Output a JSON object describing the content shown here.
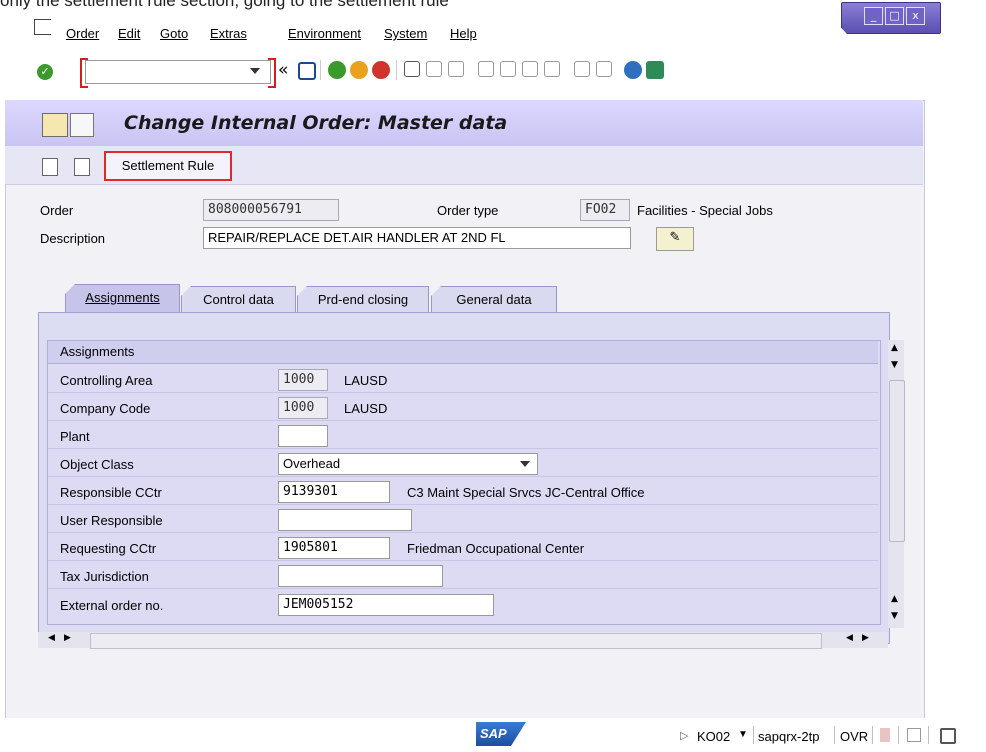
{
  "caption": "only the settlement rule section, going to the settlement rule",
  "menu": [
    "Order",
    "Edit",
    "Goto",
    "Extras",
    "Environment",
    "System",
    "Help"
  ],
  "window_controls": {
    "minimize": "_",
    "maximize": "□",
    "close": "x"
  },
  "toolbar": {
    "command_value": "",
    "history_label": "«"
  },
  "title": "Change Internal Order: Master data",
  "app_toolbar": {
    "settlement_rule": "Settlement Rule"
  },
  "header": {
    "order_label": "Order",
    "order_value": "808000056791",
    "order_type_label": "Order type",
    "order_type_value": "FO02",
    "order_type_desc": "Facilities  - Special Jobs",
    "description_label": "Description",
    "description_value": "REPAIR/REPLACE DET.AIR HANDLER AT 2ND FL"
  },
  "tabs": [
    "Assignments",
    "Control data",
    "Prd-end closing",
    "General data"
  ],
  "group_title": "Assignments",
  "fields": {
    "controlling_area": {
      "label": "Controlling Area",
      "value": "1000",
      "desc": "LAUSD"
    },
    "company_code": {
      "label": "Company Code",
      "value": "1000",
      "desc": "LAUSD"
    },
    "plant": {
      "label": "Plant",
      "value": ""
    },
    "object_class": {
      "label": "Object Class",
      "value": "Overhead"
    },
    "responsible_cctr": {
      "label": "Responsible CCtr",
      "value": "9139301",
      "desc": "C3 Maint Special Srvcs JC-Central Office"
    },
    "user_responsible": {
      "label": "User Responsible",
      "value": ""
    },
    "requesting_cctr": {
      "label": "Requesting CCtr",
      "value": "1905801",
      "desc": "Friedman Occupational Center"
    },
    "tax_jurisdiction": {
      "label": "Tax Jurisdiction",
      "value": ""
    },
    "external_order": {
      "label": "External order no.",
      "value": "JEM005152"
    }
  },
  "status": {
    "sap_logo": "SAP",
    "tcode": "KO02",
    "server": "sapqrx-2tp",
    "mode": "OVR"
  },
  "colors": {
    "title_bar": "#c9c4f2",
    "panel": "#dcdcf2",
    "highlight": "#e02a2a"
  }
}
